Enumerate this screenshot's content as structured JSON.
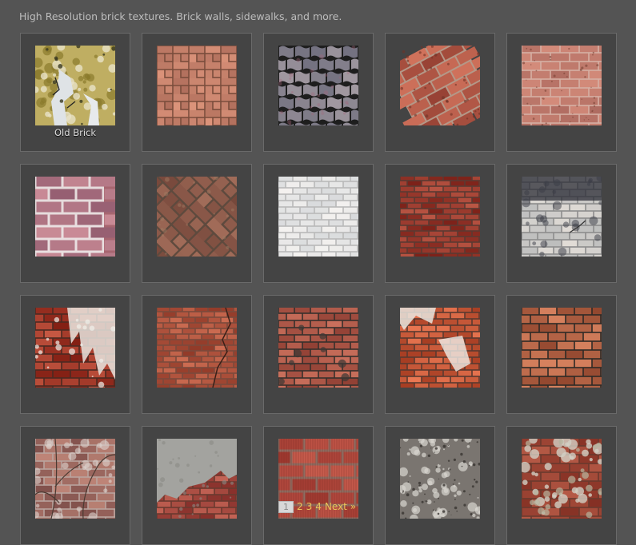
{
  "intro": "High Resolution brick textures. Brick walls, sidewalks, and more.",
  "tiles": [
    {
      "caption": "Old Brick",
      "kind": "old-brick"
    },
    {
      "caption": "",
      "kind": "herringbone-paver"
    },
    {
      "caption": "",
      "kind": "interlock-gray"
    },
    {
      "caption": "",
      "kind": "engraved-diagonal"
    },
    {
      "caption": "",
      "kind": "engraved-wall"
    },
    {
      "caption": "",
      "kind": "painted-white-pink"
    },
    {
      "caption": "",
      "kind": "herringbone-diagonal"
    },
    {
      "caption": "",
      "kind": "white-painted"
    },
    {
      "caption": "",
      "kind": "red-wall"
    },
    {
      "caption": "",
      "kind": "gray-dirty"
    },
    {
      "caption": "",
      "kind": "white-dripped-red"
    },
    {
      "caption": "",
      "kind": "cracked-red"
    },
    {
      "caption": "",
      "kind": "red-wall-dark"
    },
    {
      "caption": "",
      "kind": "white-patch-red"
    },
    {
      "caption": "",
      "kind": "red-rough"
    },
    {
      "caption": "",
      "kind": "vine-wall"
    },
    {
      "caption": "",
      "kind": "concrete-over-brick"
    },
    {
      "caption": "",
      "kind": "scored-brick"
    },
    {
      "caption": "",
      "kind": "gray-lichen"
    },
    {
      "caption": "",
      "kind": "red-lichen"
    }
  ],
  "pagination": {
    "current": "1",
    "pages": [
      "2",
      "3",
      "4"
    ],
    "next": "Next »"
  },
  "colors": {
    "page_bg": "#545454",
    "tile_bg": "#444444",
    "link": "#e8c45a"
  }
}
